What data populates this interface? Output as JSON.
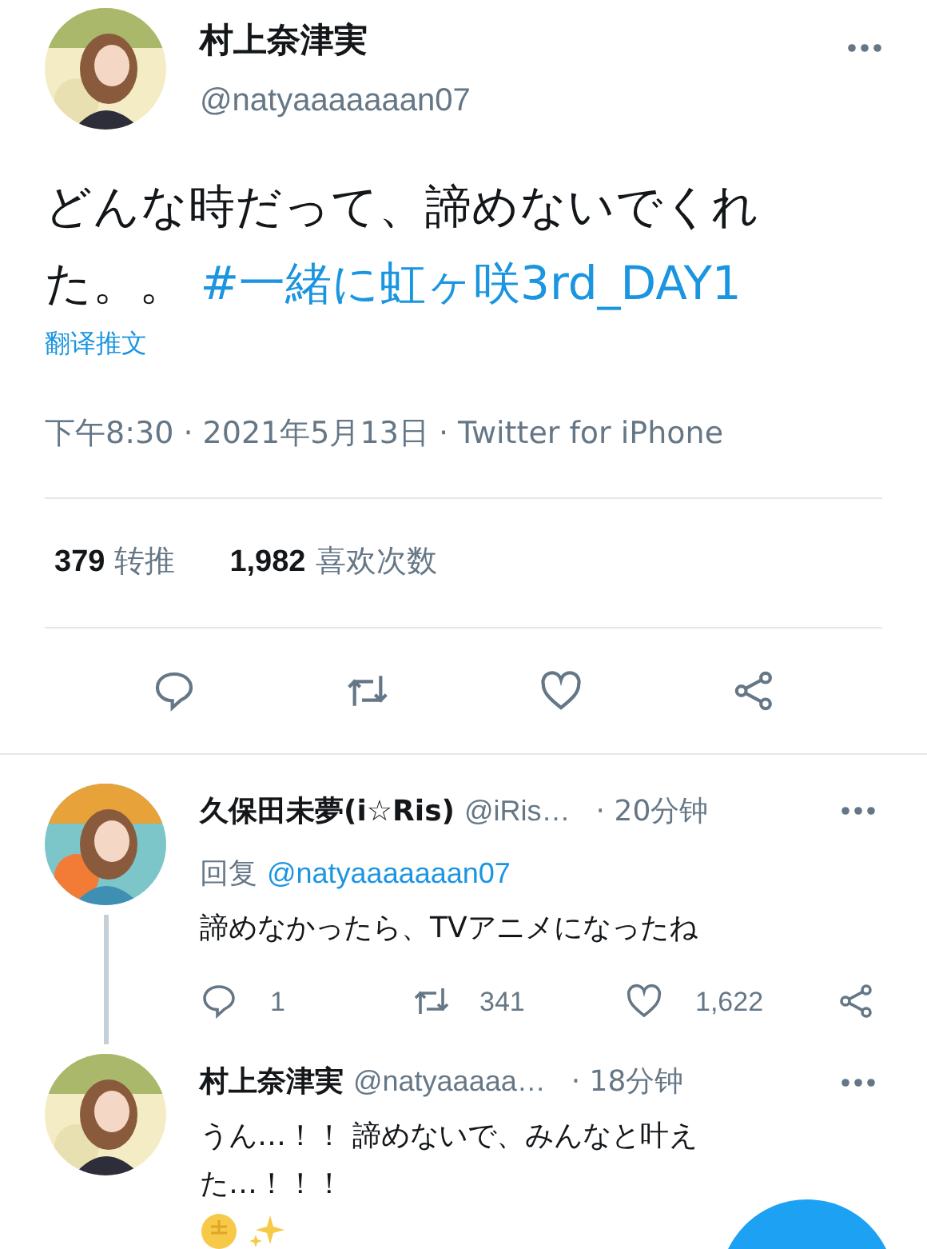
{
  "tweet": {
    "name": "村上奈津実",
    "handle": "@natyaaaaaaan07",
    "text": "どんな時だって、諦めないでくれた。。",
    "hashtag": "#一緒に虹ヶ咲3rd_DAY1",
    "translate": "翻译推文",
    "meta": "下午8:30 · 2021年5月13日 · Twitter for iPhone",
    "stats": [
      {
        "count": "379",
        "label": "转推"
      },
      {
        "count": "1,982",
        "label": "喜欢次数"
      }
    ]
  },
  "replies": [
    {
      "name": "久保田未夢(i☆Ris)",
      "handle": "@iRis…",
      "time": "· 20分钟",
      "reply_label": "回复",
      "reply_to": "@natyaaaaaaan07",
      "text": "諦めなかったら、TVアニメになったね",
      "counts": {
        "reply": "1",
        "retweet": "341",
        "like": "1,622"
      },
      "thread_line": true
    },
    {
      "name": "村上奈津実",
      "handle": "@natyaaaaa…",
      "time": "· 18分钟",
      "text": "うん…！！ 諦めないで、みんなと叶えた…！！！",
      "thread_line": false
    }
  ]
}
